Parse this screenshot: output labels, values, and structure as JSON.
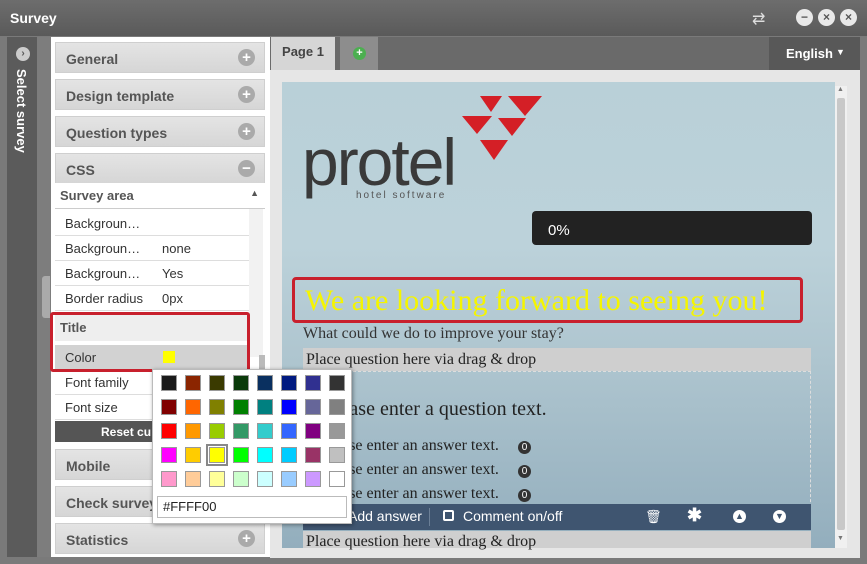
{
  "window": {
    "title": "Survey"
  },
  "left_strip": {
    "label": "Select survey"
  },
  "sections": {
    "general": "General",
    "design_template": "Design template",
    "question_types": "Question types",
    "css": "CSS",
    "mobile": "Mobile",
    "check_survey": "Check survey",
    "statistics": "Statistics"
  },
  "css_panel": {
    "survey_area_label": "Survey area",
    "rows": [
      {
        "label": "Backgroun…",
        "value": ""
      },
      {
        "label": "Backgroun…",
        "value": "none"
      },
      {
        "label": "Backgroun…",
        "value": "Yes"
      },
      {
        "label": "Border radius",
        "value": "0px"
      }
    ],
    "title_label": "Title",
    "title_rows": [
      {
        "label": "Color",
        "value_color": "#FFFF00"
      },
      {
        "label": "Font family",
        "value": ""
      },
      {
        "label": "Font size",
        "value": ""
      }
    ],
    "reset_label": "Reset cu"
  },
  "tabs": {
    "page1": "Page 1"
  },
  "language": {
    "selected": "English"
  },
  "survey": {
    "logo_text": "protel",
    "logo_subtext": "hotel software",
    "progress": "0%",
    "title": "We are looking forward to seeing you!",
    "subtitle": "What could we do to improve your stay?",
    "dropzone_top": "Place question here via drag & drop",
    "question": "lease enter a question text.",
    "answers": [
      "ease enter an answer text.",
      "ease enter an answer text.",
      "ease enter an answer text."
    ],
    "answer_badge": "0",
    "toolbar": {
      "add_answer": "Add answer",
      "comment": "Comment on/off"
    },
    "dropzone_bottom": "Place question here via drag & drop"
  },
  "color_picker": {
    "hex_value": "#FFFF00",
    "swatches": [
      [
        "#1a1a1a",
        "#8b2500",
        "#3a3a00",
        "#0a3a0a",
        "#0a3060",
        "#001a80",
        "#303090",
        "#333333"
      ],
      [
        "#800000",
        "#ff6600",
        "#808000",
        "#008000",
        "#008080",
        "#0000ff",
        "#666699",
        "#808080"
      ],
      [
        "#ff0000",
        "#ff9900",
        "#99cc00",
        "#339966",
        "#33cccc",
        "#3366ff",
        "#800080",
        "#999999"
      ],
      [
        "#ff00ff",
        "#ffcc00",
        "#ffff00",
        "#00ff00",
        "#00ffff",
        "#00ccff",
        "#993366",
        "#c0c0c0"
      ],
      [
        "#ff99cc",
        "#ffcc99",
        "#ffff99",
        "#ccffcc",
        "#ccffff",
        "#99ccff",
        "#cc99ff",
        "#ffffff"
      ]
    ],
    "selected": "#ffff00"
  },
  "colors": {
    "highlight": "#c8202d",
    "title_yellow": "#f5f500",
    "logo_red": "#d41f26"
  }
}
